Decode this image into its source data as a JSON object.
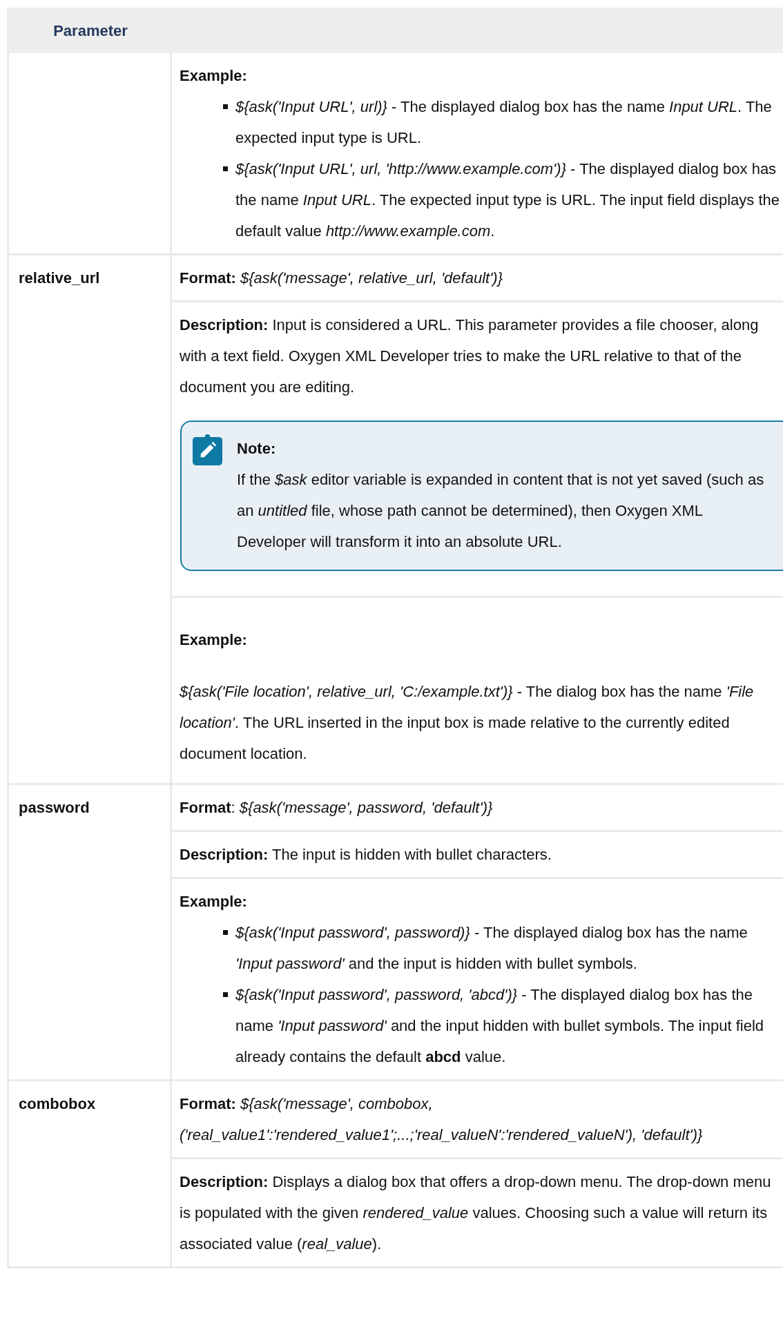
{
  "table": {
    "header": "Parameter",
    "rows": [
      {
        "blocks": [
          {
            "kind": "example",
            "label": "Example:",
            "items": [
              "*${ask('Input URL', url)}* - The displayed dialog box has the name *Input URL*. The expected input type is URL.",
              "*${ask('Input URL', url, 'http://www.example.com')}* - The displayed dialog box has the name *Input URL*. The expected input type is URL. The input field displays the default value *http://www.example.com*."
            ]
          }
        ]
      },
      {
        "parameter": "relative_url",
        "blocks": [
          {
            "kind": "paragraph",
            "text": "**Format:** *${ask('message', relative_url, 'default')}*"
          },
          {
            "kind": "paragraph",
            "text": "**Description:** Input is considered a URL. This parameter provides a file chooser, along with a text field. Oxygen XML Developer tries to make the URL relative to that of the document you are editing.",
            "note": {
              "title": "Note:",
              "text": "If the *$ask* editor variable is expanded in content that is not yet saved (such as an *untitled* file, whose path cannot be determined), then Oxygen XML Developer will transform it into an absolute URL."
            }
          },
          {
            "kind": "example_text",
            "label": "Example:",
            "text": "*${ask('File location', relative_url, 'C:/example.txt')}* - The dialog box has the name *'File location'*. The URL inserted in the input box is made relative to the currently edited document location."
          }
        ]
      },
      {
        "parameter": "password",
        "blocks": [
          {
            "kind": "paragraph",
            "text": "**Format**: *${ask('message', password, 'default')}*"
          },
          {
            "kind": "paragraph",
            "text": "**Description:** The input is hidden with bullet characters."
          },
          {
            "kind": "example",
            "label": "Example:",
            "items": [
              "*${ask('Input password', password)}* - The displayed dialog box has the name *'Input password'* and the input is hidden with bullet symbols.",
              "*${ask('Input password', password, 'abcd')}* - The displayed dialog box has the name *'Input password'* and the input hidden with bullet symbols. The input field already contains the default **abcd** value."
            ]
          }
        ]
      },
      {
        "parameter": "combobox",
        "blocks": [
          {
            "kind": "paragraph",
            "text": "**Format:** *${ask('message', combobox, ('real_value1':'rendered_value1';...;'real_valueN':'rendered_valueN'), 'default')}*"
          },
          {
            "kind": "paragraph",
            "text": "**Description:** Displays a dialog box that offers a drop-down menu. The drop-down menu is populated with the given *rendered_value* values. Choosing such a value will return its associated value (*real_value*)."
          }
        ]
      }
    ]
  }
}
